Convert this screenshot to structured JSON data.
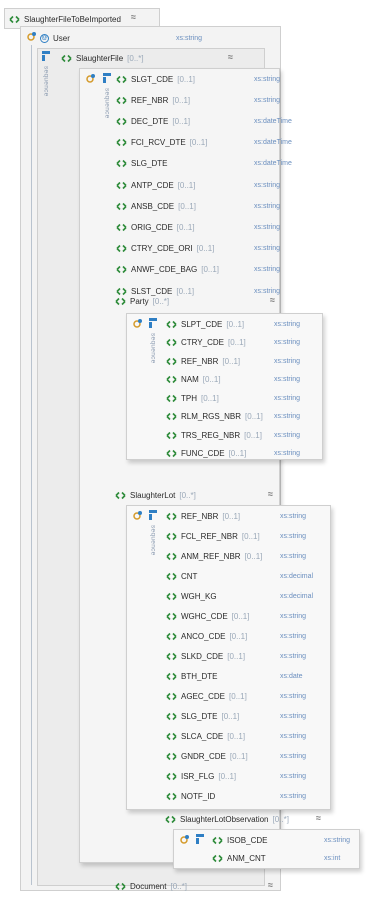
{
  "root": {
    "name": "SlaughterFileToBeImported",
    "collapse": "≈"
  },
  "level1": [
    {
      "name": "User",
      "kind": "attribute",
      "type": "xs:string"
    },
    {
      "name": "SlaughterFile",
      "cardinality": "[0..*]",
      "collapse": "≈"
    }
  ],
  "sequence_label": "sequence",
  "slaughter_file_fields": [
    {
      "name": "SLGT_CDE",
      "cardinality": "[0..1]",
      "type": "xs:string"
    },
    {
      "name": "REF_NBR",
      "cardinality": "[0..1]",
      "type": "xs:string"
    },
    {
      "name": "DEC_DTE",
      "cardinality": "[0..1]",
      "type": "xs:dateTime"
    },
    {
      "name": "FCI_RCV_DTE",
      "cardinality": "[0..1]",
      "type": "xs:dateTime"
    },
    {
      "name": "SLG_DTE",
      "cardinality": "",
      "type": "xs:dateTime"
    },
    {
      "name": "ANTP_CDE",
      "cardinality": "[0..1]",
      "type": "xs:string"
    },
    {
      "name": "ANSB_CDE",
      "cardinality": "[0..1]",
      "type": "xs:string"
    },
    {
      "name": "ORIG_CDE",
      "cardinality": "[0..1]",
      "type": "xs:string"
    },
    {
      "name": "CTRY_CDE_ORI",
      "cardinality": "[0..1]",
      "type": "xs:string"
    },
    {
      "name": "ANWF_CDE_BAG",
      "cardinality": "[0..1]",
      "type": "xs:string"
    },
    {
      "name": "SLST_CDE",
      "cardinality": "[0..1]",
      "type": "xs:string"
    }
  ],
  "party": {
    "name": "Party",
    "cardinality": "[0..*]",
    "collapse": "≈"
  },
  "party_fields": [
    {
      "name": "SLPT_CDE",
      "cardinality": "[0..1]",
      "type": "xs:string"
    },
    {
      "name": "CTRY_CDE",
      "cardinality": "[0..1]",
      "type": "xs:string"
    },
    {
      "name": "REF_NBR",
      "cardinality": "[0..1]",
      "type": "xs:string"
    },
    {
      "name": "NAM",
      "cardinality": "[0..1]",
      "type": "xs:string"
    },
    {
      "name": "TPH",
      "cardinality": "[0..1]",
      "type": "xs:string"
    },
    {
      "name": "RLM_RGS_NBR",
      "cardinality": "[0..1]",
      "type": "xs:string"
    },
    {
      "name": "TRS_REG_NBR",
      "cardinality": "[0..1]",
      "type": "xs:string"
    },
    {
      "name": "FUNC_CDE",
      "cardinality": "[0..1]",
      "type": "xs:string"
    }
  ],
  "slaughter_lot": {
    "name": "SlaughterLot",
    "cardinality": "[0..*]",
    "collapse": "≈"
  },
  "slaughter_lot_fields": [
    {
      "name": "REF_NBR",
      "cardinality": "[0..1]",
      "type": "xs:string"
    },
    {
      "name": "FCL_REF_NBR",
      "cardinality": "[0..1]",
      "type": "xs:string"
    },
    {
      "name": "ANM_REF_NBR",
      "cardinality": "[0..1]",
      "type": "xs:string"
    },
    {
      "name": "CNT",
      "cardinality": "",
      "type": "xs:decimal"
    },
    {
      "name": "WGH_KG",
      "cardinality": "",
      "type": "xs:decimal"
    },
    {
      "name": "WGHC_CDE",
      "cardinality": "[0..1]",
      "type": "xs:string"
    },
    {
      "name": "ANCO_CDE",
      "cardinality": "[0..1]",
      "type": "xs:string"
    },
    {
      "name": "SLKD_CDE",
      "cardinality": "[0..1]",
      "type": "xs:string"
    },
    {
      "name": "BTH_DTE",
      "cardinality": "",
      "type": "xs:date"
    },
    {
      "name": "AGEC_CDE",
      "cardinality": "[0..1]",
      "type": "xs:string"
    },
    {
      "name": "SLG_DTE",
      "cardinality": "[0..1]",
      "type": "xs:string"
    },
    {
      "name": "SLCA_CDE",
      "cardinality": "[0..1]",
      "type": "xs:string"
    },
    {
      "name": "GNDR_CDE",
      "cardinality": "[0..1]",
      "type": "xs:string"
    },
    {
      "name": "ISR_FLG",
      "cardinality": "[0..1]",
      "type": "xs:string"
    },
    {
      "name": "NOTF_ID",
      "cardinality": "",
      "type": "xs:string"
    }
  ],
  "observation": {
    "name": "SlaughterLotObservation",
    "cardinality": "[0..*]",
    "collapse": "≈"
  },
  "observation_fields": [
    {
      "name": "ISOB_CDE",
      "cardinality": "",
      "type": "xs:string"
    },
    {
      "name": "ANM_CNT",
      "cardinality": "",
      "type": "xs:int"
    }
  ],
  "document": {
    "name": "Document",
    "cardinality": "[0..*]",
    "collapse": "≈"
  },
  "colors": {
    "element_icon": "#2e8b3a",
    "sequence_icon": "#2f7fc4",
    "type_text": "#6b8fbf",
    "cardinality_text": "#9aa8b8"
  }
}
